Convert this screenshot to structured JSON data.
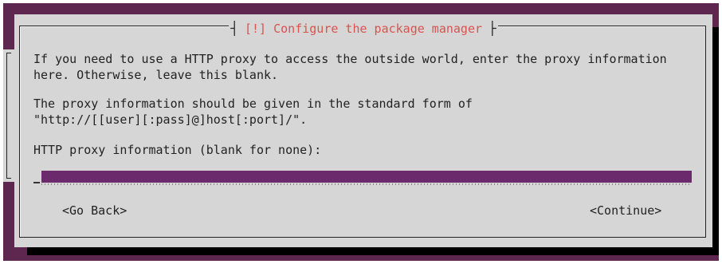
{
  "dialog": {
    "title_mark": "[!]",
    "title": "Configure the package manager",
    "paragraph1_line1": "If you need to use a HTTP proxy to access the outside world, enter the proxy information",
    "paragraph1_line2": "here. Otherwise, leave this blank.",
    "paragraph2_line1": "The proxy information should be given in the standard form of",
    "paragraph2_line2": "\"http://[[user][:pass]@]host[:port]/\".",
    "field_label": "HTTP proxy information (blank for none):",
    "field_value": "",
    "go_back_label": "<Go Back>",
    "continue_label": "<Continue>"
  },
  "colors": {
    "background": "#5e2750",
    "dialog": "#d6d6d6",
    "title_text": "#d9534f",
    "input": "#6b2a6b"
  }
}
